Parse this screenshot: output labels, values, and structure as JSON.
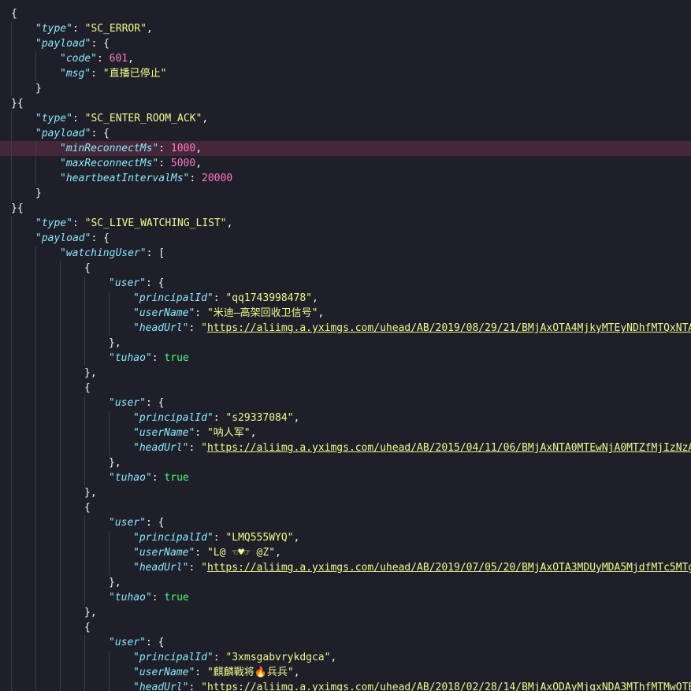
{
  "lines": [
    {
      "d": 0,
      "t": [
        {
          "c": "p",
          "v": "{"
        }
      ]
    },
    {
      "d": 1,
      "t": [
        {
          "c": "key",
          "v": "\"type\""
        },
        {
          "c": "p",
          "v": ": "
        },
        {
          "c": "str",
          "v": "\"SC_ERROR\""
        },
        {
          "c": "p",
          "v": ","
        }
      ]
    },
    {
      "d": 1,
      "t": [
        {
          "c": "key",
          "v": "\"payload\""
        },
        {
          "c": "p",
          "v": ": {"
        }
      ]
    },
    {
      "d": 2,
      "t": [
        {
          "c": "key",
          "v": "\"code\""
        },
        {
          "c": "p",
          "v": ": "
        },
        {
          "c": "num",
          "v": "601"
        },
        {
          "c": "p",
          "v": ","
        }
      ]
    },
    {
      "d": 2,
      "t": [
        {
          "c": "key",
          "v": "\"msg\""
        },
        {
          "c": "p",
          "v": ": "
        },
        {
          "c": "str",
          "v": "\"直播已停止\""
        }
      ]
    },
    {
      "d": 1,
      "t": [
        {
          "c": "p",
          "v": "}"
        }
      ]
    },
    {
      "d": 0,
      "t": [
        {
          "c": "p",
          "v": "}{"
        }
      ]
    },
    {
      "d": 1,
      "t": [
        {
          "c": "key",
          "v": "\"type\""
        },
        {
          "c": "p",
          "v": ": "
        },
        {
          "c": "str",
          "v": "\"SC_ENTER_ROOM_ACK\""
        },
        {
          "c": "p",
          "v": ","
        }
      ]
    },
    {
      "d": 1,
      "t": [
        {
          "c": "key",
          "v": "\"payload\""
        },
        {
          "c": "p",
          "v": ": {"
        }
      ]
    },
    {
      "d": 2,
      "hl": true,
      "t": [
        {
          "c": "key",
          "v": "\"minReconnectMs\""
        },
        {
          "c": "p",
          "v": ": "
        },
        {
          "c": "num",
          "v": "1000"
        },
        {
          "c": "p",
          "v": ","
        }
      ]
    },
    {
      "d": 2,
      "t": [
        {
          "c": "key",
          "v": "\"maxReconnectMs\""
        },
        {
          "c": "p",
          "v": ": "
        },
        {
          "c": "num",
          "v": "5000"
        },
        {
          "c": "p",
          "v": ","
        }
      ]
    },
    {
      "d": 2,
      "t": [
        {
          "c": "key",
          "v": "\"heartbeatIntervalMs\""
        },
        {
          "c": "p",
          "v": ": "
        },
        {
          "c": "num",
          "v": "20000"
        }
      ]
    },
    {
      "d": 1,
      "t": [
        {
          "c": "p",
          "v": "}"
        }
      ]
    },
    {
      "d": 0,
      "t": [
        {
          "c": "p",
          "v": "}{"
        }
      ]
    },
    {
      "d": 1,
      "t": [
        {
          "c": "key",
          "v": "\"type\""
        },
        {
          "c": "p",
          "v": ": "
        },
        {
          "c": "str",
          "v": "\"SC_LIVE_WATCHING_LIST\""
        },
        {
          "c": "p",
          "v": ","
        }
      ]
    },
    {
      "d": 1,
      "t": [
        {
          "c": "key",
          "v": "\"payload\""
        },
        {
          "c": "p",
          "v": ": {"
        }
      ]
    },
    {
      "d": 2,
      "t": [
        {
          "c": "key",
          "v": "\"watchingUser\""
        },
        {
          "c": "p",
          "v": ": ["
        }
      ]
    },
    {
      "d": 3,
      "t": [
        {
          "c": "p",
          "v": "{"
        }
      ]
    },
    {
      "d": 4,
      "t": [
        {
          "c": "key",
          "v": "\"user\""
        },
        {
          "c": "p",
          "v": ": {"
        }
      ]
    },
    {
      "d": 5,
      "t": [
        {
          "c": "key",
          "v": "\"principalId\""
        },
        {
          "c": "p",
          "v": ": "
        },
        {
          "c": "str",
          "v": "\"qq1743998478\""
        },
        {
          "c": "p",
          "v": ","
        }
      ]
    },
    {
      "d": 5,
      "t": [
        {
          "c": "key",
          "v": "\"userName\""
        },
        {
          "c": "p",
          "v": ": "
        },
        {
          "c": "str",
          "v": "\"米迪—高架回收卫信号\""
        },
        {
          "c": "p",
          "v": ","
        }
      ]
    },
    {
      "d": 5,
      "t": [
        {
          "c": "key",
          "v": "\"headUrl\""
        },
        {
          "c": "p",
          "v": ": "
        },
        {
          "c": "str",
          "v": "\""
        },
        {
          "c": "url",
          "v": "https://aliimg.a.yximgs.com/uhead/AB/2019/08/29/21/BMjAxOTA4MjkyMTEyNDhfMTQxNTAz"
        }
      ]
    },
    {
      "d": 4,
      "t": [
        {
          "c": "p",
          "v": "},"
        }
      ]
    },
    {
      "d": 4,
      "t": [
        {
          "c": "key",
          "v": "\"tuhao\""
        },
        {
          "c": "p",
          "v": ": "
        },
        {
          "c": "bool",
          "v": "true"
        }
      ]
    },
    {
      "d": 3,
      "t": [
        {
          "c": "p",
          "v": "},"
        }
      ]
    },
    {
      "d": 3,
      "t": [
        {
          "c": "p",
          "v": "{"
        }
      ]
    },
    {
      "d": 4,
      "t": [
        {
          "c": "key",
          "v": "\"user\""
        },
        {
          "c": "p",
          "v": ": {"
        }
      ]
    },
    {
      "d": 5,
      "t": [
        {
          "c": "key",
          "v": "\"principalId\""
        },
        {
          "c": "p",
          "v": ": "
        },
        {
          "c": "str",
          "v": "\"s29337084\""
        },
        {
          "c": "p",
          "v": ","
        }
      ]
    },
    {
      "d": 5,
      "t": [
        {
          "c": "key",
          "v": "\"userName\""
        },
        {
          "c": "p",
          "v": ": "
        },
        {
          "c": "str",
          "v": "\"呐人军\""
        },
        {
          "c": "p",
          "v": ","
        }
      ]
    },
    {
      "d": 5,
      "t": [
        {
          "c": "key",
          "v": "\"headUrl\""
        },
        {
          "c": "p",
          "v": ": "
        },
        {
          "c": "str",
          "v": "\""
        },
        {
          "c": "url",
          "v": "https://aliimg.a.yximgs.com/uhead/AB/2015/04/11/06/BMjAxNTA0MTEwNjA0MTZfMjIzNzA5"
        }
      ]
    },
    {
      "d": 4,
      "t": [
        {
          "c": "p",
          "v": "},"
        }
      ]
    },
    {
      "d": 4,
      "t": [
        {
          "c": "key",
          "v": "\"tuhao\""
        },
        {
          "c": "p",
          "v": ": "
        },
        {
          "c": "bool",
          "v": "true"
        }
      ]
    },
    {
      "d": 3,
      "t": [
        {
          "c": "p",
          "v": "},"
        }
      ]
    },
    {
      "d": 3,
      "t": [
        {
          "c": "p",
          "v": "{"
        }
      ]
    },
    {
      "d": 4,
      "t": [
        {
          "c": "key",
          "v": "\"user\""
        },
        {
          "c": "p",
          "v": ": {"
        }
      ]
    },
    {
      "d": 5,
      "t": [
        {
          "c": "key",
          "v": "\"principalId\""
        },
        {
          "c": "p",
          "v": ": "
        },
        {
          "c": "str",
          "v": "\"LMQ555WYQ\""
        },
        {
          "c": "p",
          "v": ","
        }
      ]
    },
    {
      "d": 5,
      "t": [
        {
          "c": "key",
          "v": "\"userName\""
        },
        {
          "c": "p",
          "v": ": "
        },
        {
          "c": "str",
          "v": "\"L@ ☜♥☞ @Z\""
        },
        {
          "c": "p",
          "v": ","
        }
      ]
    },
    {
      "d": 5,
      "t": [
        {
          "c": "key",
          "v": "\"headUrl\""
        },
        {
          "c": "p",
          "v": ": "
        },
        {
          "c": "str",
          "v": "\""
        },
        {
          "c": "url",
          "v": "https://aliimg.a.yximgs.com/uhead/AB/2019/07/05/20/BMjAxOTA3MDUyMDA5MjdfMTc5MTg1"
        }
      ]
    },
    {
      "d": 4,
      "t": [
        {
          "c": "p",
          "v": "},"
        }
      ]
    },
    {
      "d": 4,
      "t": [
        {
          "c": "key",
          "v": "\"tuhao\""
        },
        {
          "c": "p",
          "v": ": "
        },
        {
          "c": "bool",
          "v": "true"
        }
      ]
    },
    {
      "d": 3,
      "t": [
        {
          "c": "p",
          "v": "},"
        }
      ]
    },
    {
      "d": 3,
      "t": [
        {
          "c": "p",
          "v": "{"
        }
      ]
    },
    {
      "d": 4,
      "t": [
        {
          "c": "key",
          "v": "\"user\""
        },
        {
          "c": "p",
          "v": ": {"
        }
      ]
    },
    {
      "d": 5,
      "t": [
        {
          "c": "key",
          "v": "\"principalId\""
        },
        {
          "c": "p",
          "v": ": "
        },
        {
          "c": "str",
          "v": "\"3xmsgabvrykdgca\""
        },
        {
          "c": "p",
          "v": ","
        }
      ]
    },
    {
      "d": 5,
      "t": [
        {
          "c": "key",
          "v": "\"userName\""
        },
        {
          "c": "p",
          "v": ": "
        },
        {
          "c": "str",
          "v": "\"麒麟戰将🔥兵兵\""
        },
        {
          "c": "p",
          "v": ","
        }
      ]
    },
    {
      "d": 5,
      "t": [
        {
          "c": "key",
          "v": "\"headUrl\""
        },
        {
          "c": "p",
          "v": ": "
        },
        {
          "c": "str",
          "v": "\""
        },
        {
          "c": "url",
          "v": "https://aliimg.a.yximgs.com/uhead/AB/2018/02/28/14/BMjAxODAyMjgxNDA3MThfMTMwOTE3"
        }
      ]
    }
  ]
}
